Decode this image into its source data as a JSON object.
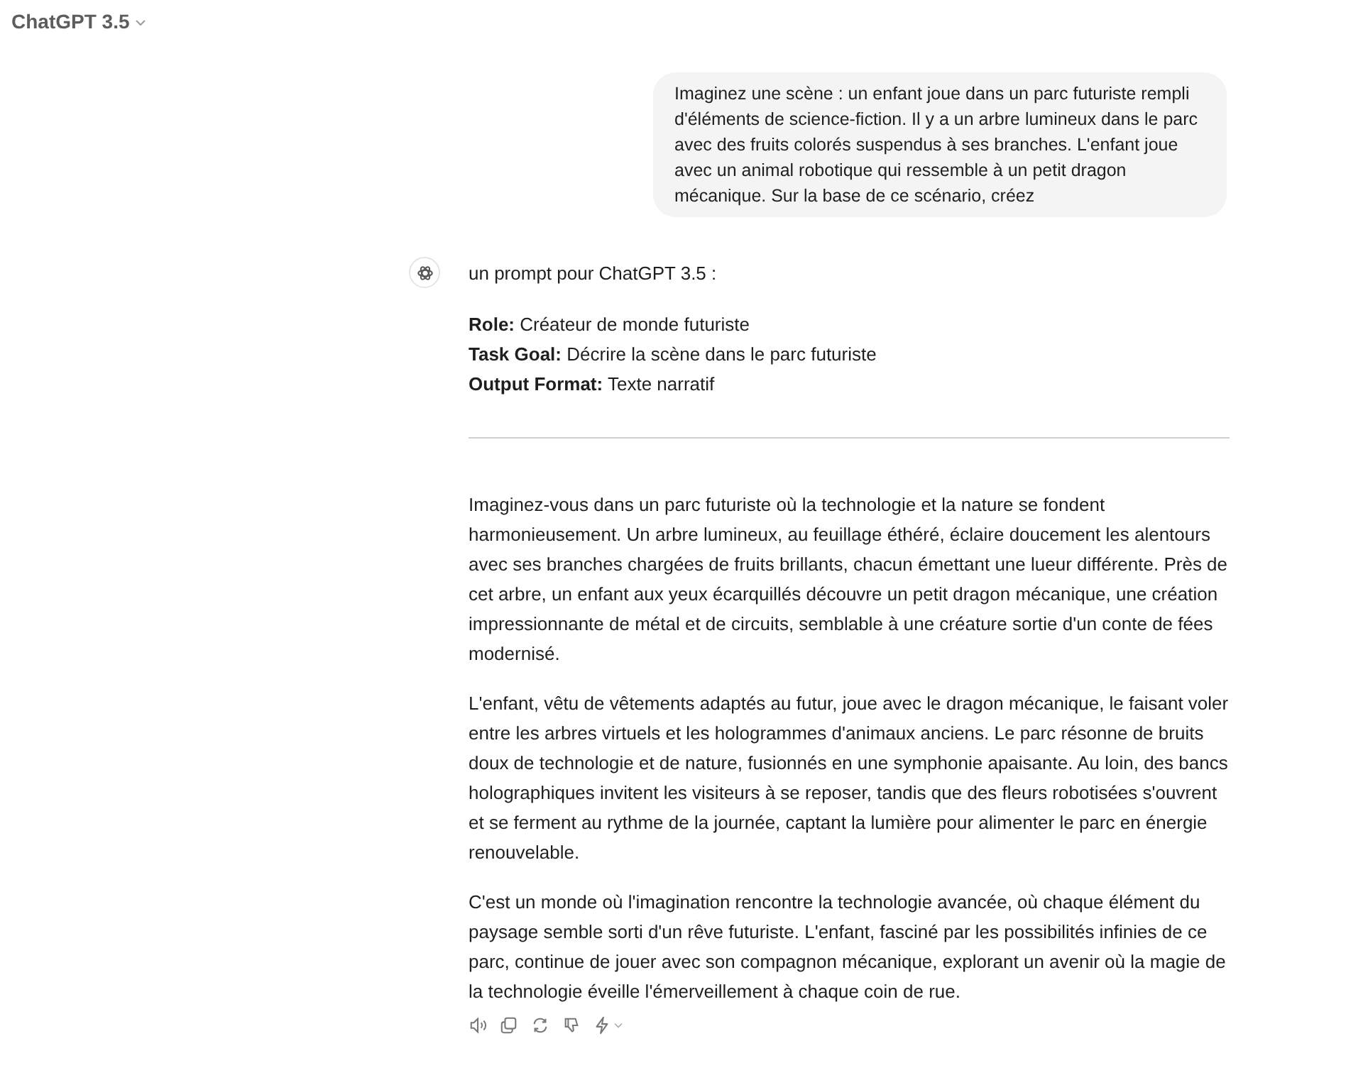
{
  "header": {
    "model": "ChatGPT 3.5"
  },
  "user_message": "Imaginez une scène : un enfant joue dans un parc futuriste rempli d'éléments de science-fiction. Il y a un arbre lumineux dans le parc avec des fruits colorés suspendus à ses branches. L'enfant joue avec un animal robotique qui ressemble à un petit dragon mécanique. Sur la base de ce scénario, créez",
  "assistant": {
    "intro": "un prompt pour ChatGPT 3.5 :",
    "fields": [
      "**Role:** Créateur de monde futuriste",
      "**Task Goal:** Décrire la scène dans le parc futuriste",
      "**Output Format:** Texte narratif"
    ],
    "paragraphs": [
      "Imaginez-vous dans un parc futuriste où la technologie et la nature se fondent harmonieusement. Un arbre lumineux, au feuillage éthéré, éclaire doucement les alentours avec ses branches chargées de fruits brillants, chacun émettant une lueur différente. Près de cet arbre, un enfant aux yeux écarquillés découvre un petit dragon mécanique, une création impressionnante de métal et de circuits, semblable à une créature sortie d'un conte de fées modernisé.",
      "L'enfant, vêtu de vêtements adaptés au futur, joue avec le dragon mécanique, le faisant voler entre les arbres virtuels et les hologrammes d'animaux anciens. Le parc résonne de bruits doux de technologie et de nature, fusionnés en une symphonie apaisante. Au loin, des bancs holographiques invitent les visiteurs à se reposer, tandis que des fleurs robotisées s'ouvrent et se ferment au rythme de la journée, captant la lumière pour alimenter le parc en énergie renouvelable.",
      "C'est un monde où l'imagination rencontre la technologie avancée, où chaque élément du paysage semble sorti d'un rêve futuriste. L'enfant, fasciné par les possibilités infinies de ce parc, continue de jouer avec son compagnon mécanique, explorant un avenir où la magie de la technologie éveille l'émerveillement à chaque coin de rue."
    ]
  }
}
